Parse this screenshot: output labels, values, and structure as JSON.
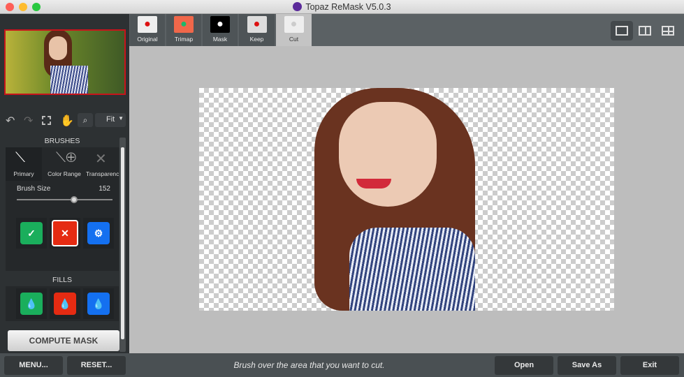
{
  "window": {
    "title": "Topaz ReMask V5.0.3"
  },
  "toolbar": {
    "zoom_select": "Fit"
  },
  "brushes": {
    "heading": "BRUSHES",
    "tabs": [
      {
        "label": "Primary",
        "selected": true
      },
      {
        "label": "Color Range"
      },
      {
        "label": "Transparency"
      }
    ],
    "size_label": "Brush Size",
    "size_value": "152",
    "size_fraction": 0.6,
    "buttons": [
      {
        "icon": "keep-brush-icon",
        "color": "#1aae5c"
      },
      {
        "icon": "cut-brush-icon",
        "color": "#e52b12",
        "selected": true
      },
      {
        "icon": "compute-brush-icon",
        "color": "#1470f0"
      }
    ]
  },
  "fills": {
    "heading": "FILLS",
    "buttons": [
      {
        "icon": "keep-fill-icon",
        "color": "#1aae5c"
      },
      {
        "icon": "cut-fill-icon",
        "color": "#e52b12"
      },
      {
        "icon": "compute-fill-icon",
        "color": "#1470f0"
      }
    ]
  },
  "compute_label": "COMPUTE MASK",
  "view_tabs": [
    {
      "label": "Original"
    },
    {
      "label": "Trimap"
    },
    {
      "label": "Mask"
    },
    {
      "label": "Keep"
    },
    {
      "label": "Cut",
      "selected": true
    }
  ],
  "footer": {
    "menu": "MENU...",
    "reset": "RESET...",
    "status": "Brush over the area that you want to cut.",
    "open": "Open",
    "save_as": "Save As",
    "exit": "Exit"
  }
}
